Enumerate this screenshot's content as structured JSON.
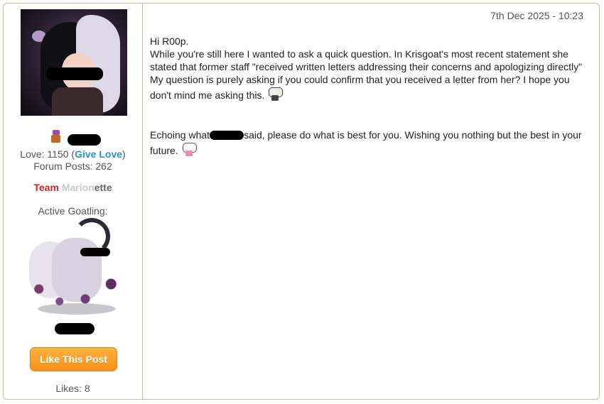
{
  "user": {
    "love_label": "Love: 1150 (",
    "give_love": "Give Love",
    "love_close": ")",
    "forum_posts": "Forum Posts: 262",
    "team_part1": "Team ",
    "team_part2": "Marion",
    "team_part3": "ette",
    "active_goatling_label": "Active Goatling:"
  },
  "actions": {
    "like_button": "Like This Post",
    "likes": "Likes: 8"
  },
  "post": {
    "date": "7th Dec 2025 - 10:23",
    "greeting": "Hi R00p.",
    "paragraph1": "While you're still here I wanted to ask a quick question. In Krisgoat's most recent statement she stated that former staff \"received written letters addressing their concerns and apologizing directly\" My question is purely asking if you could confirm that you received a letter from her? I hope you don't mind me asking this.",
    "paragraph2_a": "Echoing what",
    "paragraph2_b": "said, please do what is best for you. Wishing you nothing but the best in your future."
  },
  "colors": {
    "border": "#c9b79a",
    "give_love": "#2a8fd0",
    "team_red": "#d62020",
    "button": "#f7921b"
  }
}
